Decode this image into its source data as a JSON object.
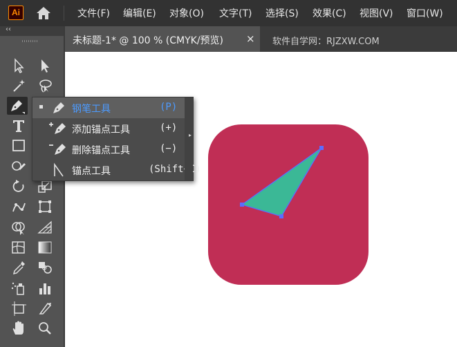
{
  "app": {
    "logo_text": "Ai",
    "accent": "#ff8a00"
  },
  "menu": {
    "items": [
      "文件(F)",
      "编辑(E)",
      "对象(O)",
      "文字(T)",
      "选择(S)",
      "效果(C)",
      "视图(V)",
      "窗口(W)"
    ]
  },
  "toolbar": {
    "collapse_glyph": "‹‹",
    "tools": [
      "selection-tool-icon",
      "direct-selection-tool-icon",
      "magic-wand-icon",
      "lasso-icon",
      "pen-tool-icon",
      "curvature-tool-icon",
      "type-tool-icon",
      "line-segment-tool-icon",
      "rectangle-tool-icon",
      "paintbrush-tool-icon",
      "shaper-tool-icon",
      "eraser-tool-icon",
      "rotate-tool-icon",
      "scale-tool-icon",
      "puppet-warp-icon",
      "free-transform-icon",
      "shape-builder-icon",
      "perspective-grid-icon",
      "mesh-tool-icon",
      "gradient-tool-icon",
      "eyedropper-icon",
      "blend-tool-icon",
      "symbol-sprayer-icon",
      "column-graph-icon",
      "artboard-tool-icon",
      "slice-tool-icon",
      "hand-tool-icon",
      "zoom-tool-icon"
    ]
  },
  "tabs": {
    "active": {
      "label": "未标题-1* @ 100 % (CMYK/预览)",
      "close": "×"
    },
    "other": {
      "label": "软件自学网：RJZXW.COM"
    }
  },
  "flyout": {
    "items": [
      {
        "label": "钢笔工具",
        "shortcut": "(P)",
        "selected": true,
        "icon": "pen-tool-icon"
      },
      {
        "label": "添加锚点工具",
        "shortcut": "(+)",
        "selected": false,
        "icon": "add-anchor-point-icon"
      },
      {
        "label": "删除锚点工具",
        "shortcut": "(−)",
        "selected": false,
        "icon": "delete-anchor-point-icon"
      },
      {
        "label": "锚点工具",
        "shortcut": "(Shift+C)",
        "selected": false,
        "icon": "anchor-point-icon"
      }
    ],
    "selected_color": "#4d9bff",
    "expand_glyph": "▸"
  },
  "artwork": {
    "square_fill": "#c02e55",
    "triangle_fill": "#3bb896",
    "path_color": "#5b6cff"
  }
}
